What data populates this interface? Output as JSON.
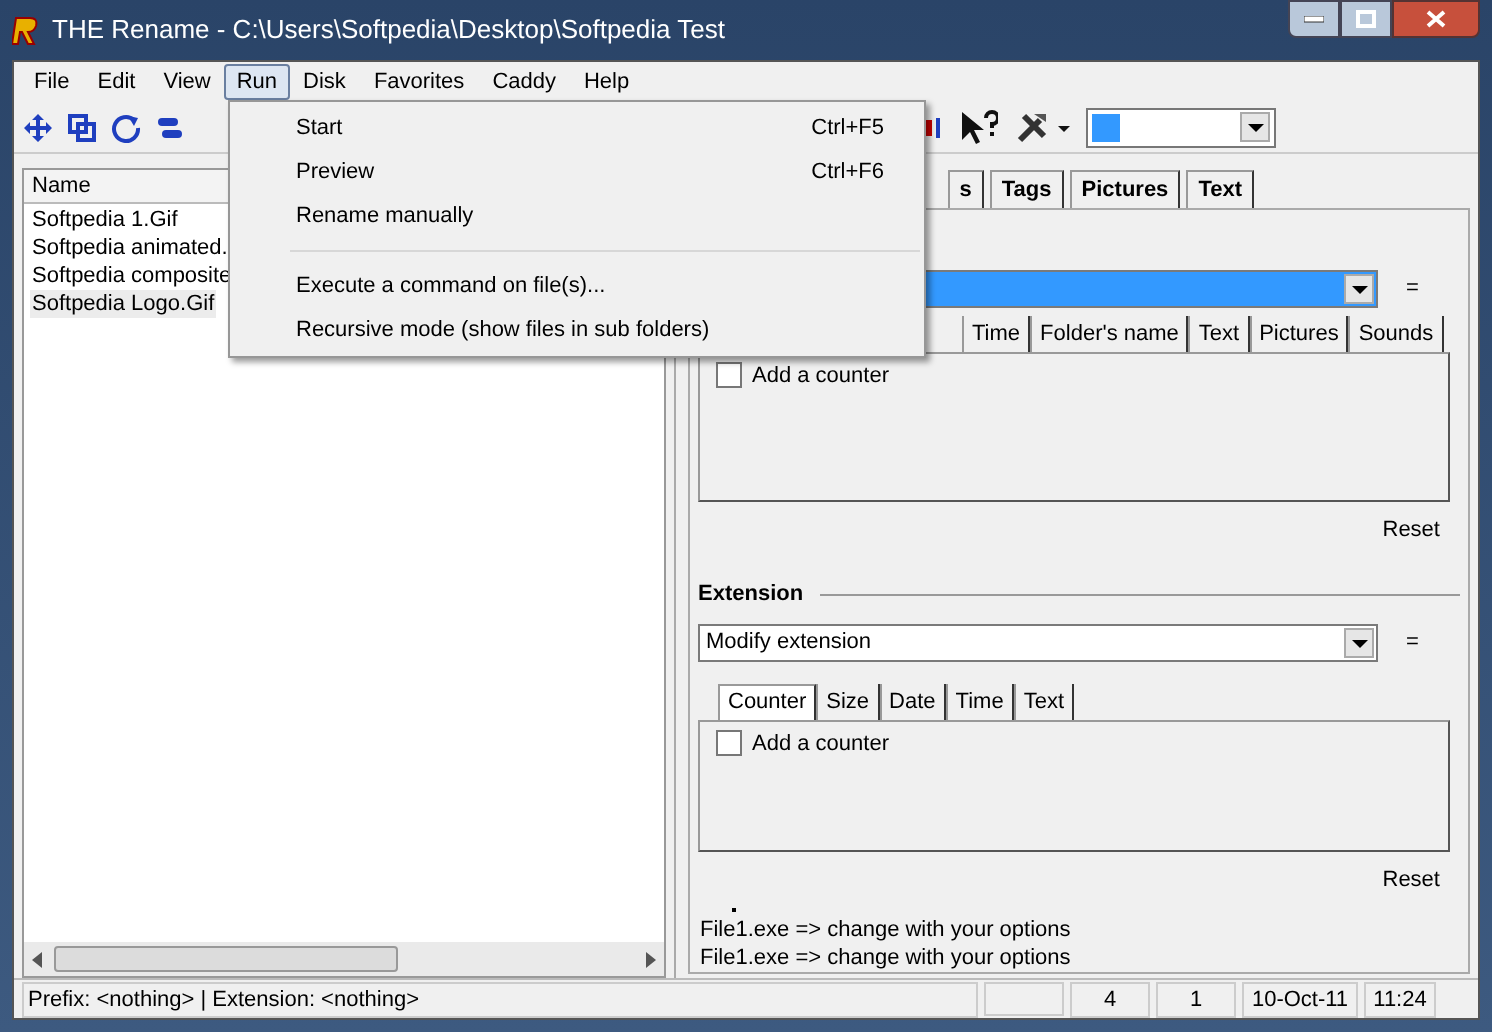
{
  "window": {
    "title": "THE Rename - C:\\Users\\Softpedia\\Desktop\\Softpedia Test"
  },
  "menu_bar": [
    {
      "label": "File",
      "selected": false
    },
    {
      "label": "Edit",
      "selected": false
    },
    {
      "label": "View",
      "selected": false
    },
    {
      "label": "Run",
      "selected": true
    },
    {
      "label": "Disk",
      "selected": false
    },
    {
      "label": "Favorites",
      "selected": false
    },
    {
      "label": "Caddy",
      "selected": false
    },
    {
      "label": "Help",
      "selected": false
    }
  ],
  "run_menu": [
    {
      "kind": "item",
      "label": "Start",
      "shortcut": "Ctrl+F5"
    },
    {
      "kind": "item",
      "label": "Preview",
      "shortcut": "Ctrl+F6"
    },
    {
      "kind": "item",
      "label": "Rename manually"
    },
    {
      "kind": "separator"
    },
    {
      "kind": "item",
      "label": "Execute a command on file(s)..."
    },
    {
      "kind": "item",
      "label": "Recursive mode (show files in sub folders)"
    }
  ],
  "file_list": {
    "columns": [
      "Name"
    ],
    "rows": [
      {
        "name": "Softpedia 1.Gif",
        "selected": false
      },
      {
        "name": "Softpedia animated.",
        "selected": false
      },
      {
        "name": "Softpedia composite",
        "selected": false
      },
      {
        "name": "Softpedia Logo.Gif",
        "selected": true
      }
    ]
  },
  "tabs": [
    {
      "label": "s",
      "selected": false
    },
    {
      "label": "Tags",
      "selected": false
    },
    {
      "label": "Pictures",
      "selected": false
    },
    {
      "label": "Text",
      "selected": false
    }
  ],
  "name_section": {
    "equals": "=",
    "subtabs": [
      {
        "label": "Time",
        "selected": false
      },
      {
        "label": "Folder's name",
        "selected": false
      },
      {
        "label": "Text",
        "selected": false
      },
      {
        "label": "Pictures",
        "selected": false
      },
      {
        "label": "Sounds",
        "selected": false
      }
    ],
    "counter": {
      "label": "Add a counter",
      "checked": false
    },
    "reset": "Reset"
  },
  "extension": {
    "heading": "Extension",
    "dropdown": "Modify extension",
    "equals": "=",
    "subtabs": [
      {
        "label": "Counter",
        "selected": true
      },
      {
        "label": "Size",
        "selected": false
      },
      {
        "label": "Date",
        "selected": false
      },
      {
        "label": "Time",
        "selected": false
      },
      {
        "label": "Text",
        "selected": false
      }
    ],
    "counter": {
      "label": "Add a counter",
      "checked": false
    },
    "reset": "Reset"
  },
  "preview": [
    "File1.exe => change with your options",
    "File1.exe => change with your options"
  ],
  "status_bar": {
    "text": "Prefix: <nothing> | Extension: <nothing>",
    "cells": [
      "4",
      "1",
      "10-Oct-11",
      "11:24"
    ]
  }
}
